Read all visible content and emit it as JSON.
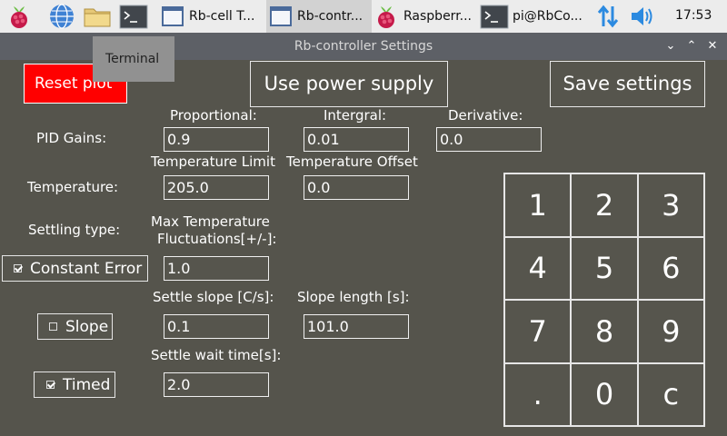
{
  "taskbar": {
    "tasks": [
      {
        "label": "Rb-cell T..."
      },
      {
        "label": "Rb-contr..."
      },
      {
        "label": "Raspberr..."
      },
      {
        "label": "pi@RbCo..."
      }
    ],
    "clock": "17:53"
  },
  "window": {
    "title": "Rb-controller Settings"
  },
  "tooltip": "Terminal",
  "buttons": {
    "reset_plot": "Reset plot",
    "use_power_supply": "Use power supply",
    "save_settings": "Save settings"
  },
  "pid": {
    "label": "PID Gains:",
    "proportional_label": "Proportional:",
    "integral_label": "Intergral:",
    "derivative_label": "Derivative:",
    "proportional": "0.9",
    "integral": "0.01",
    "derivative": "0.0"
  },
  "temperature": {
    "label": "Temperature:",
    "limit_label": "Temperature Limit",
    "offset_label": "Temperature Offset",
    "limit": "205.0",
    "offset": "0.0"
  },
  "settling": {
    "label": "Settling type:",
    "max_fluct_label_1": "Max Temperature",
    "max_fluct_label_2": "Fluctuations[+/-]:",
    "max_fluct": "1.0",
    "constant_error": {
      "label": "Constant Error",
      "checked": true
    },
    "slope": {
      "label": "Slope",
      "checked": false
    },
    "timed": {
      "label": "Timed",
      "checked": true
    },
    "slope_label": "Settle slope [C/s]:",
    "slope_length_label": "Slope length [s]:",
    "slope_value": "0.1",
    "slope_length": "101.0",
    "wait_label": "Settle wait time[s]:",
    "wait_value": "2.0"
  },
  "keypad": [
    "1",
    "2",
    "3",
    "4",
    "5",
    "6",
    "7",
    "8",
    "9",
    ".",
    "0",
    "c"
  ]
}
